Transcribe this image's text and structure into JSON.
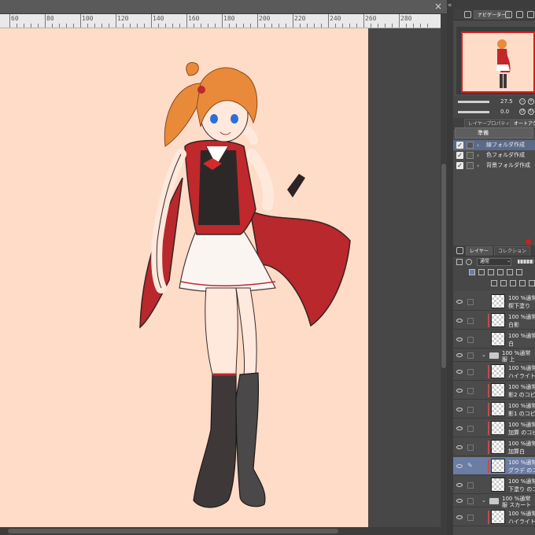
{
  "ruler": {
    "labels": [
      "60",
      "80",
      "100",
      "120",
      "140",
      "160",
      "180",
      "200",
      "220",
      "240",
      "260",
      "280"
    ]
  },
  "window": {
    "close_glyph": "×"
  },
  "panel": {
    "collapse_glyph": "«"
  },
  "panels": {
    "navigator_tab": "ナビゲーター",
    "layer_property_tab": "レイヤープロパティ",
    "auto_action_tab": "オートアクション",
    "layer_tab": "レイヤー",
    "second_tab": "コレクション"
  },
  "navigator": {
    "zoom": "27.5",
    "rotation": "0.0"
  },
  "auto_action": {
    "set_name": "準備",
    "items": [
      {
        "label": "線フォルダ作成",
        "checked": true,
        "selected": true
      },
      {
        "label": "色フォルダ作成",
        "checked": true,
        "selected": false
      },
      {
        "label": "背景フォルダ作成",
        "checked": true,
        "selected": false
      }
    ]
  },
  "layer_panel": {
    "blend_mode": "通常"
  },
  "layers": [
    {
      "mode": "100 %通常",
      "name": "楔下塗り",
      "type": "layer",
      "clip": false,
      "selected": false
    },
    {
      "mode": "100 %通常",
      "name": "白影",
      "type": "layer",
      "clip": true,
      "selected": false
    },
    {
      "mode": "100 %通常",
      "name": "白",
      "type": "layer",
      "clip": false,
      "selected": false
    },
    {
      "mode": "100 %通常",
      "name": "服 上",
      "type": "folder",
      "clip": false,
      "selected": false
    },
    {
      "mode": "100 %通常",
      "name": "ハイライト (",
      "type": "layer",
      "clip": true,
      "selected": false
    },
    {
      "mode": "100 %通常",
      "name": "影2 のコピー",
      "type": "layer",
      "clip": true,
      "selected": false
    },
    {
      "mode": "100 %通常",
      "name": "影1 のコピー",
      "type": "layer",
      "clip": true,
      "selected": false
    },
    {
      "mode": "100 %通常",
      "name": "加算 のコピー",
      "type": "layer",
      "clip": true,
      "selected": false
    },
    {
      "mode": "100 %通常",
      "name": "加算白",
      "type": "layer",
      "clip": true,
      "selected": false
    },
    {
      "mode": "100 %通常",
      "name": "グラデ のコピ",
      "type": "layer",
      "clip": true,
      "selected": true
    },
    {
      "mode": "100 %通常",
      "name": "下塗り のコピ",
      "type": "layer",
      "clip": false,
      "selected": false
    },
    {
      "mode": "100 %通常",
      "name": "服 スカート",
      "type": "folder",
      "clip": false,
      "selected": false
    },
    {
      "mode": "100 %通常",
      "name": "ハイライト",
      "type": "layer",
      "clip": true,
      "selected": false
    }
  ],
  "colors": {
    "canvas": "#ffdcc8",
    "navigator_frame": "#d21e1e",
    "selection": "#6b7da5",
    "coat": "#c0282c",
    "hair": "#e98a3a",
    "boots": "#3f3838"
  }
}
